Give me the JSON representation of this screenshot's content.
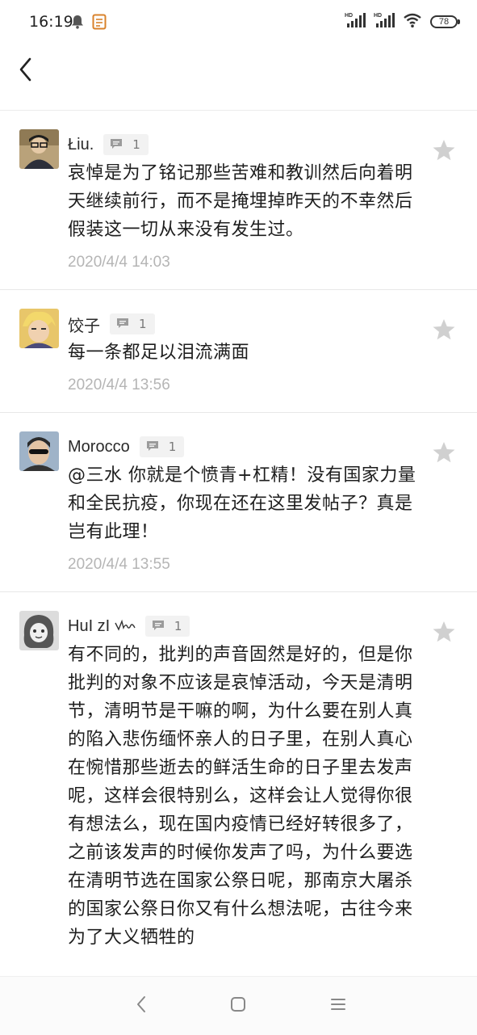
{
  "status_bar": {
    "time": "16:19",
    "battery": "78",
    "icons": [
      "bell-icon",
      "notes-app-icon",
      "hd-signal-icon",
      "hd-signal-icon",
      "wifi-icon",
      "battery-icon"
    ],
    "hd_label": "HD"
  },
  "header": {
    "back_icon": "chevron-left-icon"
  },
  "comments": [
    {
      "name": "Łiu.",
      "reply_count": "1",
      "body": "哀悼是为了铭记那些苦难和教训然后向着明天继续前行，而不是掩埋掉昨天的不幸然后假装这一切从来没有发生过。",
      "time": "2020/4/4 14:03"
    },
    {
      "name": "饺子",
      "reply_count": "1",
      "body": "每一条都足以泪流满面",
      "time": "2020/4/4 13:56"
    },
    {
      "name": "Morocco",
      "reply_count": "1",
      "body": "@三水 你就是个愤青+杠精！没有国家力量和全民抗疫，你现在还在这里发帖子？真是岂有此理！",
      "time": "2020/4/4 13:55"
    },
    {
      "name": "HuI zI",
      "reply_count": "1",
      "body": "有不同的，批判的声音固然是好的，但是你批判的对象不应该是哀悼活动，今天是清明节，清明节是干嘛的啊，为什么要在别人真的陷入悲伤缅怀亲人的日子里，在别人真心在惋惜那些逝去的鲜活生命的日子里去发声呢，这样会很特别么，这样会让人觉得你很有想法么，现在国内疫情已经好转很多了，之前该发声的时候你发声了吗，为什么要选在清明节选在国家公祭日呢，那南京大屠杀的国家公祭日你又有什么想法呢，古往今来为了大义牺牲的",
      "time": ""
    }
  ],
  "nav_bar": {
    "icons": [
      "back-nav-icon",
      "home-nav-icon",
      "menu-nav-icon"
    ]
  },
  "colors": {
    "text": "#1e1e1e",
    "timestamp": "#b5b5b5",
    "chip_bg": "#f2f2f2",
    "star": "#d0d0d0",
    "divider": "#e7e7e7"
  }
}
